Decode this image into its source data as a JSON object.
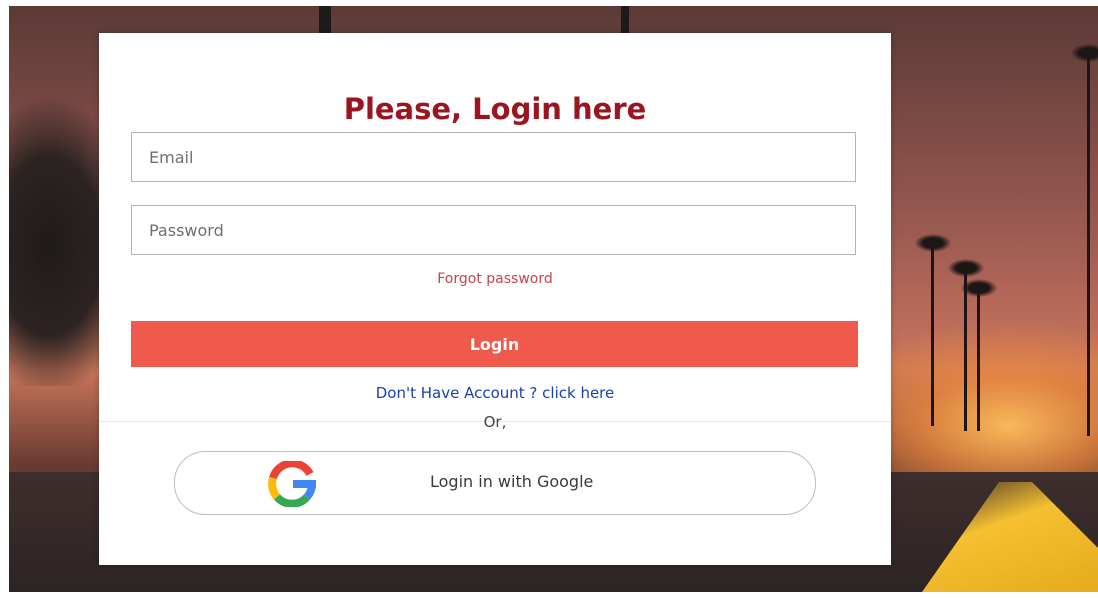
{
  "login_form": {
    "title": "Please, Login here",
    "email_placeholder": "Email",
    "password_placeholder": "Password",
    "forgot_password": "Forgot password",
    "login_button": "Login",
    "signup_link": "Don't Have Account ? click here",
    "or_separator": "Or,",
    "google_button": "Login in with Google"
  },
  "icons": {
    "google": "google-logo-icon"
  },
  "colors": {
    "title": "#9b1520",
    "login_button": "#f05a4c",
    "forgot_link": "#c2464c",
    "signup_link": "#1a3fb0"
  }
}
